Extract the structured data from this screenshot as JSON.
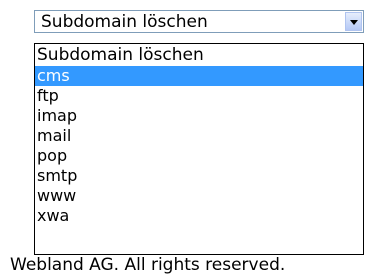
{
  "select": {
    "value": "Subdomain löschen",
    "options": [
      "Subdomain löschen",
      "cms",
      "ftp",
      "imap",
      "mail",
      "pop",
      "smtp",
      "www",
      "xwa"
    ],
    "highlighted_option": "cms"
  },
  "footer": {
    "text": "Webland AG. All rights reserved."
  },
  "colors": {
    "highlight": "#3399ff",
    "highlight_text": "#ffffff"
  },
  "icons": {
    "dropdown": "chevron-down-icon"
  }
}
